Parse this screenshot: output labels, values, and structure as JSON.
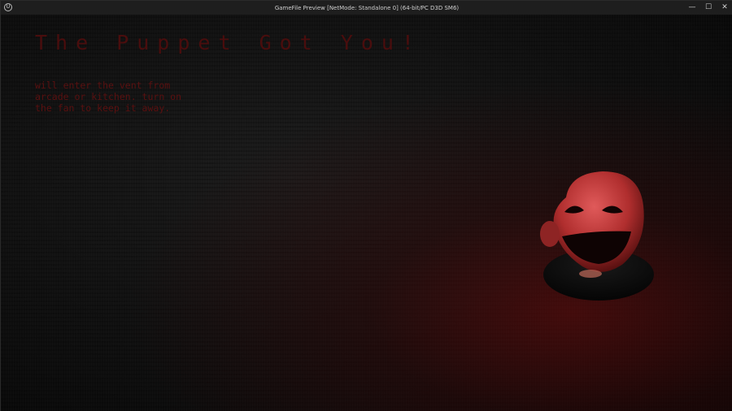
{
  "window": {
    "title": "GameFile Preview [NetMode: Standalone 0]  (64-bit/PC D3D SM6)",
    "logo_text": "U",
    "controls": {
      "minimize": "—",
      "maximize": "☐",
      "close": "✕"
    }
  },
  "game": {
    "death_title": "The Puppet Got You!",
    "hint": "will enter the vent from arcade or kitchen. turn on the fan to keep it away.",
    "character_icon": "puppet-mask-icon"
  },
  "colors": {
    "title_text": "#4a0d0d",
    "hint_text": "#5a1010",
    "mask": "#c83a3a",
    "background": "#111111"
  }
}
